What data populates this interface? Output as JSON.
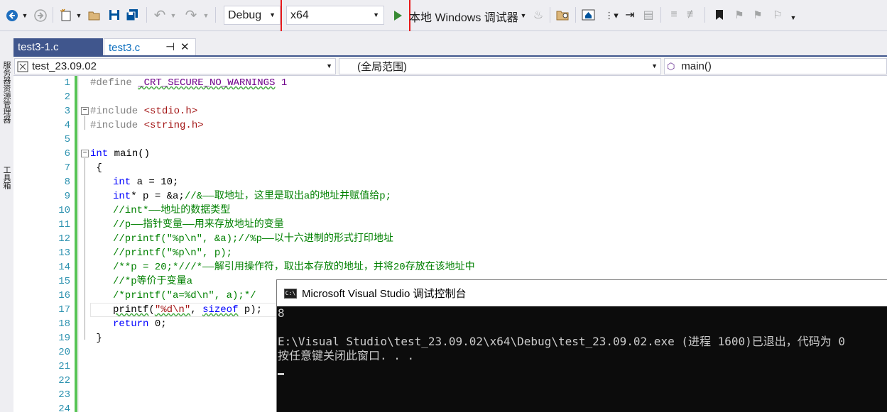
{
  "toolbar": {
    "config": "Debug",
    "platform": "x64",
    "run_label": "本地 Windows 调试器",
    "icons": [
      "back-icon",
      "forward-icon",
      "new-project-icon",
      "open-icon",
      "save-icon",
      "save-all-icon",
      "undo-icon",
      "redo-icon",
      "run-icon",
      "fire-icon",
      "find-in-files-icon",
      "home-icon",
      "step-icon",
      "indent-icon",
      "comment-icon",
      "uncomment-icon",
      "bookmark-icon",
      "prev-bookmark-icon",
      "next-bookmark-icon",
      "clear-bookmark-icon",
      "more-icon"
    ]
  },
  "side_panel": {
    "label1": "服务器资源管理器",
    "label2": "工具箱"
  },
  "tabs": [
    {
      "label": "test3-1.c",
      "active": false
    },
    {
      "label": "test3.c",
      "active": true
    }
  ],
  "nav": {
    "project": "test_23.09.02",
    "scope": "(全局范围)",
    "member": "main()"
  },
  "code": {
    "line_numbers": [
      "1",
      "2",
      "3",
      "4",
      "5",
      "6",
      "7",
      "8",
      "9",
      "10",
      "11",
      "12",
      "13",
      "14",
      "15",
      "16",
      "17",
      "18",
      "19",
      "20",
      "21",
      "22",
      "23",
      "24"
    ],
    "l1_a": "#define ",
    "l1_b": "_CRT_SECURE_NO_WARNINGS",
    "l1_c": " 1",
    "l3_a": "#include ",
    "l3_b": "<stdio.h>",
    "l4_a": "#include ",
    "l4_b": "<string.h>",
    "l6_a": "int",
    "l6_b": " main()",
    "l7": " {",
    "l8_a": "int",
    "l8_b": " a = 10;",
    "l9_a": "int",
    "l9_b": "* p = &a;",
    "l9_c": "//&——取地址，这里是取出a的地址并赋值给p;",
    "l10": "//int*——地址的数据类型",
    "l11": "//p——指针变量——用来存放地址的变量",
    "l12": "//printf(\"%p\\n\", &a);//%p——以十六进制的形式打印地址",
    "l13": "//printf(\"%p\\n\", p);",
    "l14": "/**p = 20;*///*——解引用操作符，取出本存放的地址，并将20存放在该地址中",
    "l15": "//*p等价于变量a",
    "l16": "/*printf(\"a=%d\\n\", a);*/",
    "l17_a": "printf",
    "l17_b": "(",
    "l17_c": "\"%d\\n\"",
    "l17_d": ", ",
    "l17_e": "sizeof",
    "l17_f": " p);",
    "l18_a": "return",
    "l18_b": " 0;",
    "l19": " }"
  },
  "console": {
    "title": "Microsoft Visual Studio 调试控制台",
    "icon": "C:\\",
    "line1": "8",
    "line2": "E:\\Visual Studio\\test_23.09.02\\x64\\Debug\\test_23.09.02.exe (进程 1600)已退出，代码为 0",
    "line3": "按任意键关闭此窗口. . ."
  }
}
